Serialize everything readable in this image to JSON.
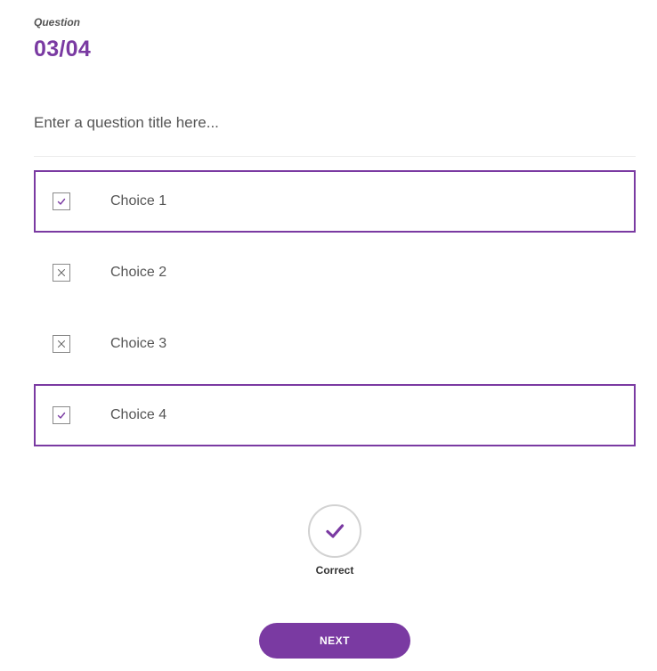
{
  "question": {
    "label": "Question",
    "number": "03/04",
    "title": "Enter a question title here..."
  },
  "choices": [
    {
      "label": "Choice 1",
      "state": "checked",
      "selected": true
    },
    {
      "label": "Choice 2",
      "state": "crossed",
      "selected": false
    },
    {
      "label": "Choice 3",
      "state": "crossed",
      "selected": false
    },
    {
      "label": "Choice 4",
      "state": "checked",
      "selected": true
    }
  ],
  "result": {
    "icon": "checkmark-icon",
    "label": "Correct"
  },
  "next_button": {
    "label": "NEXT"
  },
  "colors": {
    "accent": "#7a3aa2",
    "border": "#d2d2d2",
    "text": "#555555"
  }
}
